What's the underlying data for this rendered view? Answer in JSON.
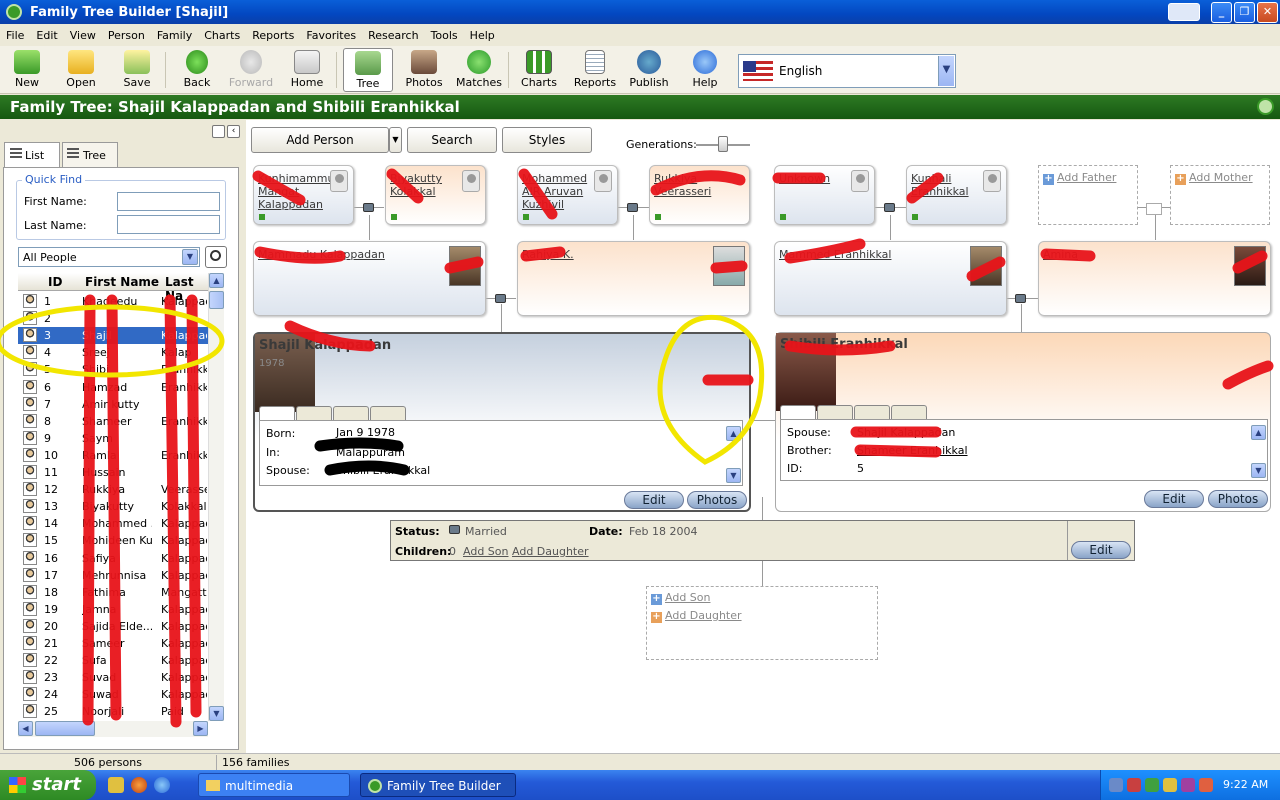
{
  "window": {
    "title": "Family Tree Builder [Shajil]"
  },
  "menu": [
    "File",
    "Edit",
    "View",
    "Person",
    "Family",
    "Charts",
    "Reports",
    "Favorites",
    "Research",
    "Tools",
    "Help"
  ],
  "toolbar": {
    "new": "New",
    "open": "Open",
    "save": "Save",
    "back": "Back",
    "forward": "Forward",
    "home": "Home",
    "tree": "Tree",
    "photos": "Photos",
    "matches": "Matches",
    "charts": "Charts",
    "reports": "Reports",
    "publish": "Publish",
    "help": "Help"
  },
  "language": "English",
  "family_tree_title": "Family Tree: Shajil Kalappadan and Shibili Eranhikkal",
  "left_panel": {
    "tab_list": "List",
    "tab_tree": "Tree",
    "quick_find": "Quick Find",
    "first_name_label": "First Name:",
    "last_name_label": "Last Name:",
    "filter": "All People",
    "columns": [
      "ID",
      "First Name",
      "Last Na"
    ],
    "rows": [
      {
        "id": "1",
        "first": "Khadeedu",
        "last": "Kalappad"
      },
      {
        "id": "2",
        "first": "",
        "last": ""
      },
      {
        "id": "3",
        "first": "Shajil",
        "last": "Kalappad"
      },
      {
        "id": "4",
        "first": "Sreej",
        "last": "Kalap"
      },
      {
        "id": "5",
        "first": "Shibi",
        "last": "Eranhikka"
      },
      {
        "id": "6",
        "first": "Hamzad",
        "last": "Eranhikka"
      },
      {
        "id": "7",
        "first": "Amir kutty",
        "last": ""
      },
      {
        "id": "8",
        "first": "Shameer",
        "last": "Eranhikka"
      },
      {
        "id": "9",
        "first": "Saym",
        "last": ""
      },
      {
        "id": "10",
        "first": "Ramla",
        "last": "Eranhikka"
      },
      {
        "id": "11",
        "first": "Hussain",
        "last": ""
      },
      {
        "id": "12",
        "first": "Rukkiya",
        "last": "Veerasseri"
      },
      {
        "id": "13",
        "first": "Biyakutty",
        "last": "Kolakkal"
      },
      {
        "id": "14",
        "first": "Mohammed ...",
        "last": "Kalappad"
      },
      {
        "id": "15",
        "first": "Mohideen Kutty",
        "last": "Kalappad"
      },
      {
        "id": "16",
        "first": "Safiya",
        "last": "Kalappad"
      },
      {
        "id": "17",
        "first": "Mehrunnisa",
        "last": "Kalappad"
      },
      {
        "id": "18",
        "first": "Fathima",
        "last": "Mangatt"
      },
      {
        "id": "19",
        "first": "Jamna",
        "last": "Kalappad"
      },
      {
        "id": "20",
        "first": "Sajida Elde...",
        "last": "Kalappad"
      },
      {
        "id": "21",
        "first": "Sameer",
        "last": "Kalappad"
      },
      {
        "id": "22",
        "first": "Sufa",
        "last": "Kalappad"
      },
      {
        "id": "23",
        "first": "Suvad",
        "last": "Kalappad"
      },
      {
        "id": "24",
        "first": "Suwad",
        "last": "Kalappad"
      },
      {
        "id": "25",
        "first": "Noorjali",
        "last": "Paid"
      }
    ]
  },
  "main": {
    "add_person": "Add Person",
    "search": "Search",
    "styles": "Styles",
    "generations": "Generations:",
    "grandparents": [
      {
        "name": "Kunhimammu Mangat Kalappadan"
      },
      {
        "name": "Biyakutty Kolakkal"
      },
      {
        "name": "Mohammed AIR Aruvan Kuzhivil"
      },
      {
        "name": "Rukkiya Veerasseri"
      },
      {
        "name": "Unknown"
      },
      {
        "name": "Kunhali Eranhikkal"
      }
    ],
    "add_father": "Add Father",
    "add_mother": "Add Mother",
    "parents": [
      {
        "name": "Mammadu Kalappadan"
      },
      {
        "name": "Rahiya K."
      },
      {
        "name": "Mammed Eranhikkal"
      },
      {
        "name": "Amina"
      }
    ],
    "husband": {
      "name": "Shajil Kalappadan",
      "year": "1978",
      "born_label": "Born:",
      "born_value": "Jan 9 1978",
      "in_label": "In:",
      "in_value": "Malappuram",
      "spouse_label": "Spouse:",
      "spouse_value": "Shibili Eranhikkal",
      "edit": "Edit",
      "photos": "Photos"
    },
    "wife": {
      "name": "Shibili Eranhikkal",
      "spouse_label": "Spouse:",
      "spouse_value": "Shajil Kalappadan",
      "brother_label": "Brother:",
      "brother_value": "Shameer Eranhikkal",
      "id_label": "ID:",
      "id_value": "5",
      "edit": "Edit",
      "photos": "Photos"
    },
    "marriage": {
      "status_label": "Status:",
      "status_value": "Married",
      "date_label": "Date:",
      "date_value": "Feb 18 2004",
      "children_label": "Children:",
      "children_count": "0",
      "add_son": "Add Son",
      "add_daughter": "Add Daughter",
      "edit": "Edit"
    },
    "children_box": {
      "add_son": "Add Son",
      "add_daughter": "Add Daughter"
    }
  },
  "status": {
    "persons": "506 persons",
    "families": "156 families"
  },
  "taskbar": {
    "start": "start",
    "task1": "multimedia",
    "task2": "Family Tree Builder",
    "clock": "9:22 AM"
  },
  "colors": {
    "title_blue": "#0a5fd8",
    "tree_green": "#2e7a24",
    "male_card": "#dde4ee",
    "female_card": "#fce2cc",
    "annotation_red": "#e8141a",
    "annotation_yellow": "#f2e600"
  }
}
